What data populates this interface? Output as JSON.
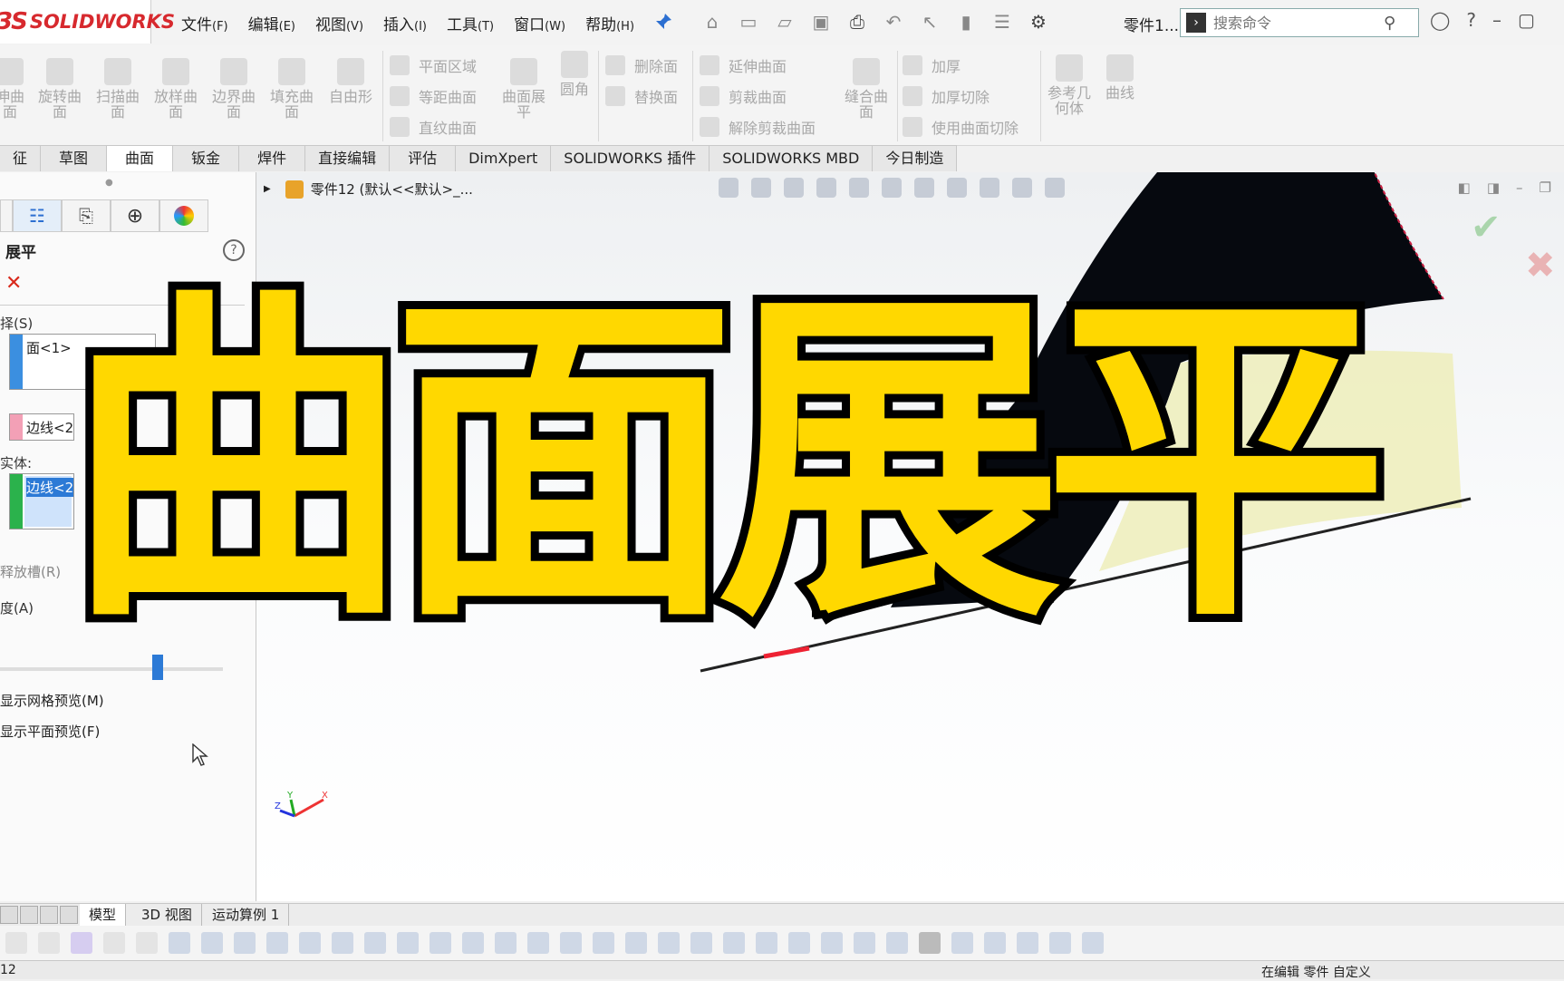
{
  "app": {
    "logo_prefix": "3S",
    "logo_text": "SOLIDWORKS",
    "doc_title": "零件1..."
  },
  "menu": [
    {
      "label": "文件",
      "key": "(F)"
    },
    {
      "label": "编辑",
      "key": "(E)"
    },
    {
      "label": "视图",
      "key": "(V)"
    },
    {
      "label": "插入",
      "key": "(I)"
    },
    {
      "label": "工具",
      "key": "(T)"
    },
    {
      "label": "窗口",
      "key": "(W)"
    },
    {
      "label": "帮助",
      "key": "(H)"
    }
  ],
  "search": {
    "placeholder": "搜索命令"
  },
  "ribbon": {
    "big_items": [
      "伸曲面",
      "旋转曲面",
      "扫描曲面",
      "放样曲面",
      "边界曲面",
      "填充曲面",
      "自由形",
      "曲面展平",
      "圆角",
      "缝合曲面",
      "参考几何体",
      "曲线"
    ],
    "rows": [
      "平面区域",
      "等距曲面",
      "直纹曲面",
      "删除面",
      "替换面",
      "延伸曲面",
      "剪裁曲面",
      "解除剪裁曲面",
      "加厚",
      "加厚切除",
      "使用曲面切除"
    ]
  },
  "command_tabs": [
    "征",
    "草图",
    "曲面",
    "钣金",
    "焊件",
    "直接编辑",
    "评估",
    "DimXpert",
    "SOLIDWORKS 插件",
    "SOLIDWORKS MBD",
    "今日制造"
  ],
  "active_tab": "曲面",
  "property_manager": {
    "title": "展平",
    "group_selection": "择(S)",
    "face_value": "面<1>",
    "edge_value": "边线<2",
    "body_label": "实体:",
    "body_value": "边线<2",
    "relief_label": "释放槽(R)",
    "accuracy_label": "度(A)",
    "accuracy_level": 0.72,
    "mesh_preview": "显示网格预览(M)",
    "flat_preview": "显示平面预览(F)"
  },
  "viewport": {
    "tree_label": "零件12  (默认<<默认>_..."
  },
  "caption": "曲面展平",
  "bottom_tabs": [
    "模型",
    "3D 视图",
    "运动算例 1"
  ],
  "status": {
    "left": "12",
    "right": "在编辑 零件      自定义"
  },
  "colors": {
    "caption_fill": "#ffd800",
    "caption_stroke": "#000000",
    "logo_red": "#d7292e"
  }
}
